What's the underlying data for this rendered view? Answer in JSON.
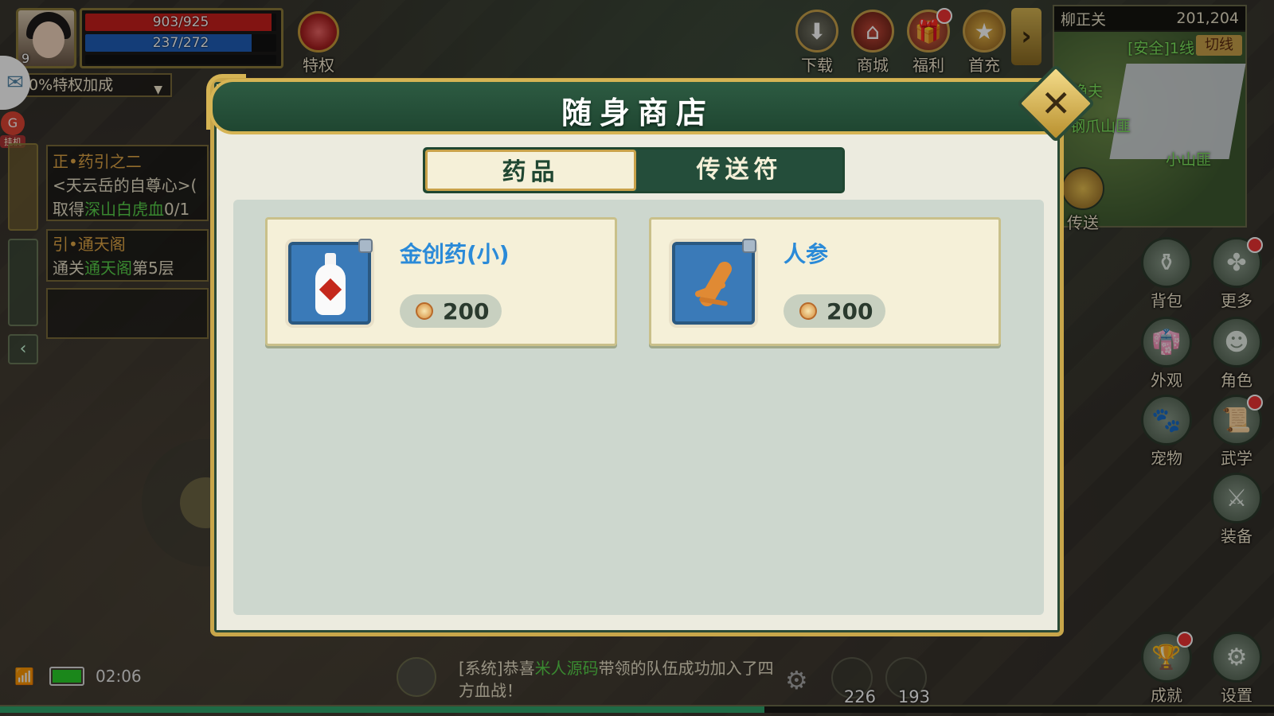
{
  "hud": {
    "level": "9",
    "hp": "903/925",
    "hp_ratio": 0.976,
    "mp": "237/272",
    "mp_ratio": 0.871,
    "privilege_label": "特权",
    "privilege_bonus": "0%特权加成",
    "afk_label": "挂机"
  },
  "quests": [
    {
      "title": "正•药引之二",
      "line1": "<天云岳的自尊心>(",
      "line2_prefix": "取得",
      "line2_target": "深山白虎血",
      "line2_suffix": "0/1"
    },
    {
      "title": "引•通天阁",
      "line1_prefix": "通关",
      "line1_target": "通天阁",
      "line1_suffix": "第5层"
    }
  ],
  "top_buttons": [
    {
      "label": "下载",
      "icon": "download-icon",
      "badge": false
    },
    {
      "label": "商城",
      "icon": "shop-icon",
      "badge": false
    },
    {
      "label": "福利",
      "icon": "gift-icon",
      "badge": true
    },
    {
      "label": "首充",
      "icon": "treasure-icon",
      "badge": false
    }
  ],
  "minimap": {
    "location": "柳正关",
    "coords": "201,204",
    "safe_line": "[安全]1线",
    "switch_line": "切线",
    "labels": [
      "寸渔夫",
      "钢爪山匪",
      "小山匪"
    ],
    "teleport": "传送"
  },
  "right_menu": [
    {
      "label": "背包",
      "icon": "bag-icon",
      "badge": false
    },
    {
      "label": "更多",
      "icon": "more-icon",
      "badge": true
    },
    {
      "label": "外观",
      "icon": "outfit-icon",
      "badge": false
    },
    {
      "label": "角色",
      "icon": "character-icon",
      "badge": false
    },
    {
      "label": "宠物",
      "icon": "pet-icon",
      "badge": false
    },
    {
      "label": "武学",
      "icon": "martial-icon",
      "badge": true
    },
    {
      "label": "装备",
      "icon": "equipment-icon",
      "badge": false
    },
    {
      "label": "成就",
      "icon": "achievement-icon",
      "badge": true
    },
    {
      "label": "设置",
      "icon": "settings-icon",
      "badge": false
    }
  ],
  "status_bar": {
    "time": "02:06"
  },
  "chat": {
    "prefix": "[系统]恭喜",
    "name": "米人源码",
    "suffix": "带领的队伍成功加入了四方血战！"
  },
  "quick_slots": [
    {
      "count": "226",
      "icon": "potion-icon"
    },
    {
      "count": "193",
      "icon": "ginseng-icon"
    }
  ],
  "shop": {
    "title": "随身商店",
    "tabs": [
      {
        "label": "药品",
        "active": true
      },
      {
        "label": "传送符",
        "active": false
      }
    ],
    "items": [
      {
        "name": "金创药(小)",
        "price": "200",
        "icon": "medicine-bottle-icon"
      },
      {
        "name": "人参",
        "price": "200",
        "icon": "ginseng-icon"
      }
    ]
  },
  "colors": {
    "hp": "#c8201c",
    "mp": "#1f5fb8",
    "accent_gold": "#c9a24a",
    "modal_green": "#1f4631",
    "item_name": "#2a8ad8"
  }
}
